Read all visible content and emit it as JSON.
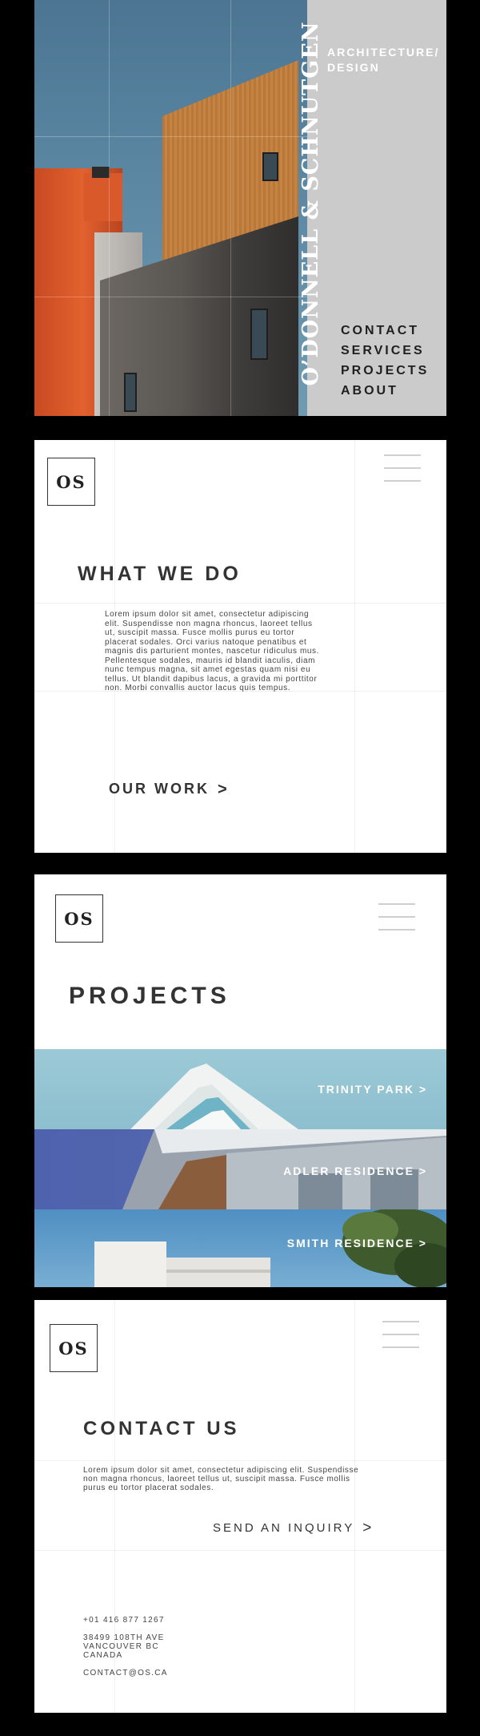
{
  "hero": {
    "firm_name": "O’DONNELL & SCHNUTGEN",
    "tagline": "ARCHITECTURE/ DESIGN",
    "nav": [
      "CONTACT",
      "SERVICES",
      "PROJECTS",
      "ABOUT"
    ]
  },
  "logo_text": "OS",
  "what_we_do": {
    "heading": "WHAT WE DO",
    "body": "Lorem ipsum dolor sit amet, consectetur adipiscing elit. Suspendisse non magna rhoncus, laoreet tellus ut, suscipit massa. Fusce mollis purus eu tortor placerat sodales. Orci varius natoque penatibus et magnis dis parturient montes, nascetur ridiculus mus. Pellentesque sodales, mauris id blandit iaculis, diam nunc tempus magna, sit amet egestas quam nisi eu tellus. Ut blandit dapibus lacus, a gravida mi porttitor non. Morbi convallis auctor lacus quis tempus.",
    "cta": "OUR WORK",
    "cta_chevron": ">"
  },
  "projects": {
    "heading": "PROJECTS",
    "items": [
      {
        "label": "TRINITY PARK >"
      },
      {
        "label": "ADLER RESIDENCE >"
      },
      {
        "label": "SMITH RESIDENCE >"
      }
    ]
  },
  "contact": {
    "heading": "CONTACT US",
    "body": "Lorem ipsum dolor sit amet, consectetur adipiscing elit. Suspendisse non magna rhoncus, laoreet tellus ut, suscipit massa. Fusce mollis purus eu tortor placerat sodales.",
    "cta": "SEND AN INQUIRY",
    "cta_chevron": ">",
    "phone": "+01 416 877 1267",
    "address_line1": "38499 108TH AVE",
    "address_line2": "VANCOUVER BC",
    "address_line3": "CANADA",
    "email": "CONTACT@OS.CA"
  },
  "colors": {
    "hero_panel": "#cbcbcb",
    "accent_orange": "#e2612e",
    "sky_blue": "#5a86a2",
    "text_dark": "#333333"
  }
}
